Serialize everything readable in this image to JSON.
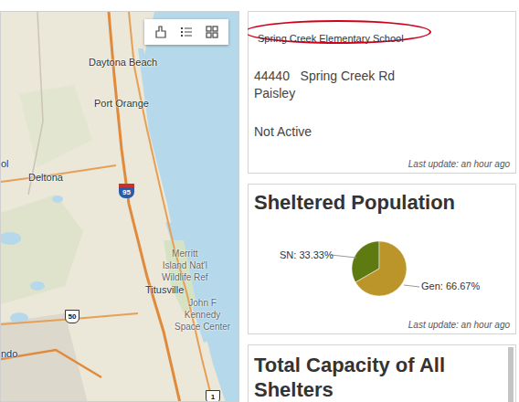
{
  "map": {
    "labels": [
      "Daytona Beach",
      "Port Orange",
      "ol",
      "Deltona",
      "Merritt\nIsland Nat'l\nWildlife Ref",
      "Titusville",
      "John F\nKennedy\nSpace Center",
      "ndo"
    ],
    "shields": [
      {
        "text": "95",
        "kind": "interstate"
      },
      {
        "text": "50",
        "kind": "us"
      },
      {
        "text": "1",
        "kind": "us"
      }
    ]
  },
  "info": {
    "title": "Spring Creek Elementary School",
    "highlighted": true,
    "address": "44440   Spring Creek Rd",
    "city": "Paisley",
    "status": "Not Active",
    "updated": "Last update: an hour ago"
  },
  "sheltered": {
    "title": "Sheltered Population",
    "series": [
      {
        "label": "SN: 33.33%",
        "value": 33.33,
        "color": "#5e7b12"
      },
      {
        "label": "Gen: 66.67%",
        "value": 66.67,
        "color": "#bb9529"
      }
    ],
    "updated": "Last update: an hour ago"
  },
  "capacity": {
    "title": "Total Capacity of All Shelters"
  }
}
